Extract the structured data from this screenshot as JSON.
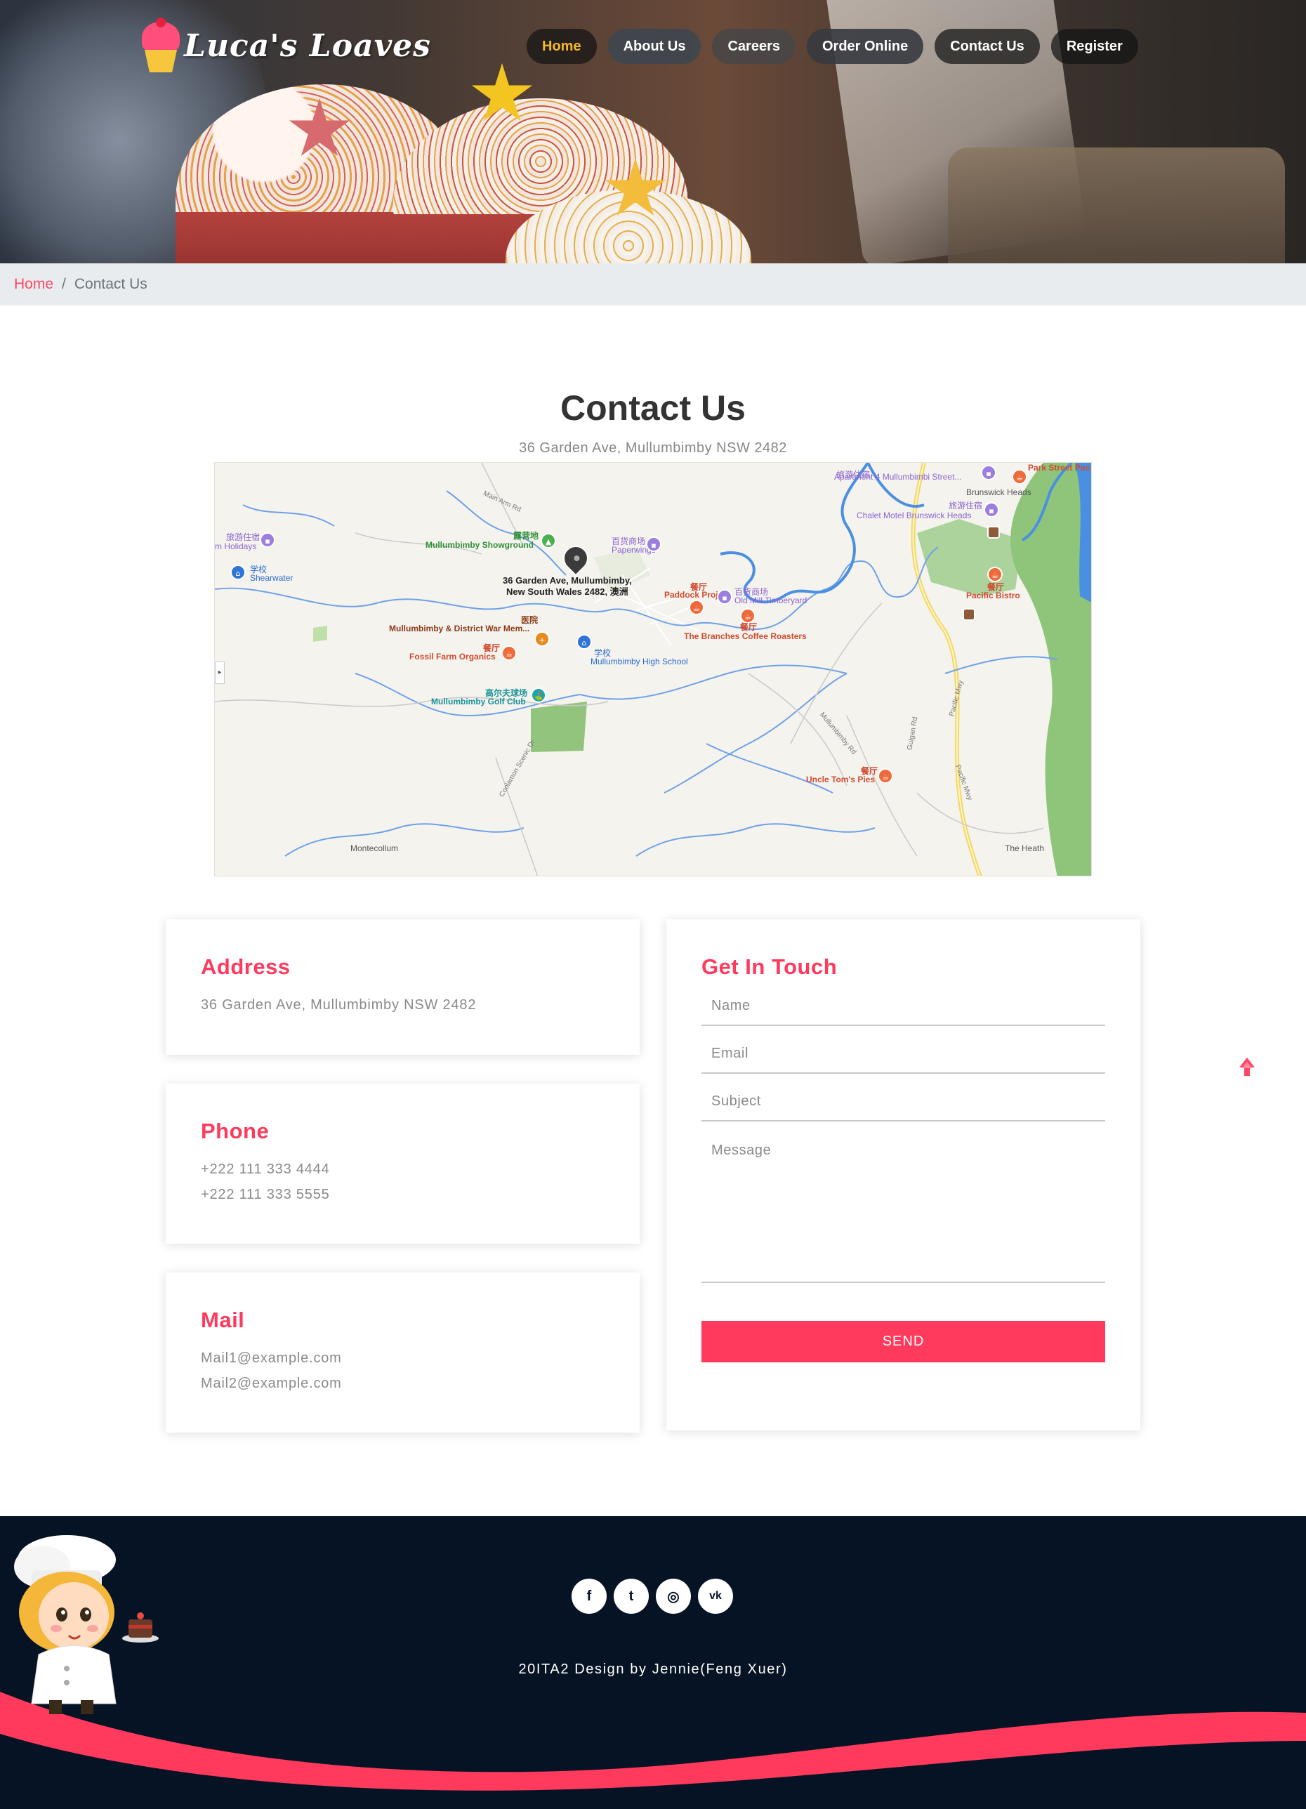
{
  "brand": {
    "name": "Luca's Loaves"
  },
  "nav": {
    "items": [
      {
        "label": "Home",
        "active": true
      },
      {
        "label": "About Us"
      },
      {
        "label": "Careers"
      },
      {
        "label": "Order Online"
      },
      {
        "label": "Contact Us"
      },
      {
        "label": "Register"
      }
    ]
  },
  "breadcrumb": {
    "home": "Home",
    "separator": "/",
    "current": "Contact Us"
  },
  "page": {
    "title": "Contact Us",
    "subtitle": "36 Garden Ave, Mullumbimby NSW 2482"
  },
  "map": {
    "pin_label_1": "36 Garden Ave, Mullumbimby,",
    "pin_label_2": "New South Wales 2482, 澳洲",
    "labels": {
      "apartment": "Apartment 4 Mullumbimbi Street...",
      "park_street": "Park Street Pas",
      "brunswick": "Brunswick Heads",
      "chalet": "Chalet Motel Brunswick Heads",
      "travel1": "旅游住宿",
      "travel2": "旅游住宿",
      "travel3": "旅游住宿",
      "holidays": "m Holidays",
      "school1": "学校",
      "shearwater": "Shearwater",
      "showground_cn": "露营地",
      "showground": "Mullumbimby Showground",
      "dept_cn": "百货商场",
      "paperwings": "Paperwings",
      "restaurant1": "餐厅",
      "paddock": "Paddock Project",
      "dept2_cn": "百货商场",
      "oldmill": "Old Mill Timberyard",
      "restaurant2": "餐厅",
      "branches": "The Branches Coffee Roasters",
      "restaurant3": "餐厅",
      "pacific": "Pacific Bistro",
      "hospital_cn": "医院",
      "warmem": "Mullumbimby & District War Mem...",
      "restaurant4": "餐厅",
      "fossil": "Fossil Farm Organics",
      "school2": "学校",
      "highschool": "Mullumbimby High School",
      "golf_cn": "高尔夫球场",
      "golf": "Mullumbimby Golf Club",
      "restaurant5": "餐厅",
      "uncletoms": "Uncle Tom's Pies",
      "montecollum": "Montecollum",
      "heath": "The Heath",
      "main_arm": "Main Arm Rd",
      "pacific_mwy": "Pacific Mwy",
      "pacific_mwy2": "Pacific Mwy",
      "mullumbimby_rd": "Mullumbimby Rd",
      "gulgan": "Gulgan Rd",
      "coolamon": "Coolamon Scenic Dr"
    }
  },
  "cards": {
    "address": {
      "title": "Address",
      "line1": "36 Garden Ave, Mullumbimby NSW 2482"
    },
    "phone": {
      "title": "Phone",
      "line1": "+222 111 333 4444",
      "line2": "+222 111 333 5555"
    },
    "mail": {
      "title": "Mail",
      "line1": "Mail1@example.com",
      "line2": "Mail2@example.com"
    }
  },
  "form": {
    "title": "Get In Touch",
    "name_placeholder": "Name",
    "email_placeholder": "Email",
    "subject_placeholder": "Subject",
    "message_placeholder": "Message",
    "send_label": "SEND"
  },
  "footer": {
    "socials": [
      {
        "icon": "facebook-icon",
        "glyph": "f"
      },
      {
        "icon": "twitter-icon",
        "glyph": "t"
      },
      {
        "icon": "dribbble-icon",
        "glyph": "◎"
      },
      {
        "icon": "vk-icon",
        "glyph": "vk"
      }
    ],
    "credit": "20ITA2 Design by Jennie(Feng Xuer)"
  },
  "colors": {
    "accent": "#ff3a5c",
    "nav_active": "#f5b729",
    "footer_bg": "#061324",
    "breadcrumb_bg": "#e9ecef"
  }
}
